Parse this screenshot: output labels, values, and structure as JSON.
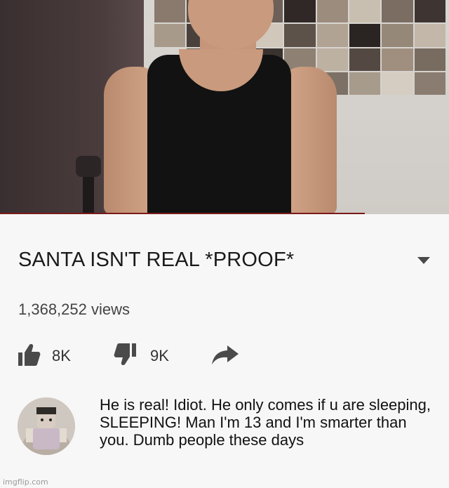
{
  "video": {
    "title": "SANTA ISN'T REAL *PROOF*",
    "views": "1,368,252 views",
    "likes": "8K",
    "dislikes": "9K",
    "expand_icon": "chevron-down-icon",
    "like_icon": "thumbs-up-icon",
    "dislike_icon": "thumbs-down-icon",
    "share_icon": "share-arrow-icon"
  },
  "comment": {
    "text": "He is real! Idiot. He only comes if u are sleeping, SLEEPING! Man I'm 13 and I'm smarter than you. Dumb people these days"
  },
  "watermark": "imgflip.com",
  "colors": {
    "background": "#f7f7f7",
    "icon": "#4a4a4a",
    "text": "#1a1a1a"
  }
}
